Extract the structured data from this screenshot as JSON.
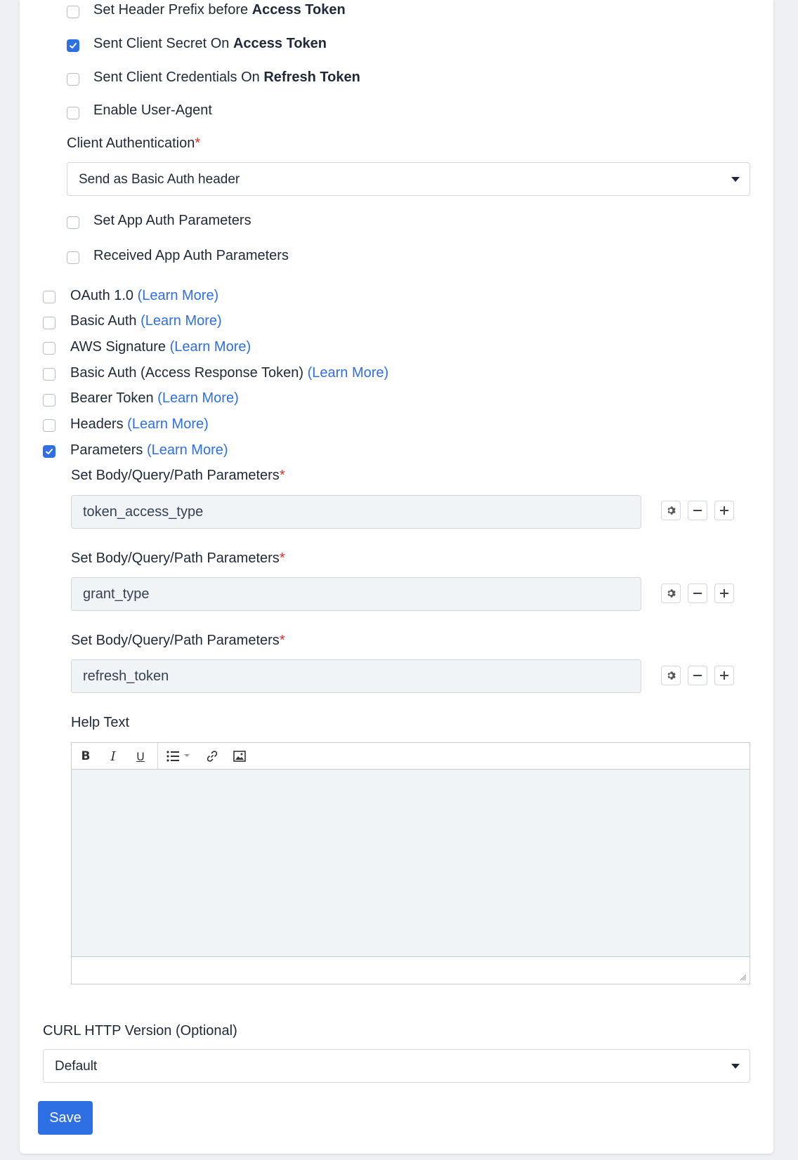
{
  "oauth2_options": [
    {
      "text": "Set Header Prefix before ",
      "bold": "Access Token",
      "checked": false
    },
    {
      "text": "Sent Client Secret On ",
      "bold": "Access Token",
      "checked": true
    },
    {
      "text": "Sent Client Credentials On ",
      "bold": "Refresh Token",
      "checked": false
    },
    {
      "text": "Enable User-Agent",
      "bold": "",
      "checked": false
    }
  ],
  "client_auth": {
    "label": "Client Authentication",
    "required_mark": "*",
    "value": "Send as Basic Auth header"
  },
  "app_auth_options": [
    {
      "text": "Set App Auth Parameters",
      "checked": false
    },
    {
      "text": "Received App Auth Parameters",
      "checked": false
    }
  ],
  "auth_types": [
    {
      "text": "OAuth 1.0",
      "link": "(Learn More)",
      "checked": false
    },
    {
      "text": "Basic Auth",
      "link": "(Learn More)",
      "checked": false
    },
    {
      "text": "AWS Signature",
      "link": "(Learn More)",
      "checked": false
    },
    {
      "text": "Basic Auth (Access Response Token)",
      "link": "(Learn More)",
      "checked": false
    },
    {
      "text": "Bearer Token",
      "link": "(Learn More)",
      "checked": false
    },
    {
      "text": "Headers",
      "link": "(Learn More)",
      "checked": false
    },
    {
      "text": "Parameters",
      "link": "(Learn More)",
      "checked": true
    }
  ],
  "parameters": [
    {
      "label": "Set Body/Query/Path Parameters",
      "required_mark": "*",
      "value": "token_access_type"
    },
    {
      "label": "Set Body/Query/Path Parameters",
      "required_mark": "*",
      "value": "grant_type"
    },
    {
      "label": "Set Body/Query/Path Parameters",
      "required_mark": "*",
      "value": "refresh_token"
    }
  ],
  "help_text": {
    "label": "Help Text",
    "toolbar_icons": [
      "bold-icon",
      "italic-icon",
      "underline-icon",
      "list-icon",
      "link-icon",
      "image-icon"
    ]
  },
  "curl": {
    "label": "CURL HTTP Version (Optional)",
    "value": "Default"
  },
  "save_label": "Save",
  "colors": {
    "accent": "#2f6fe4",
    "required": "#d93025"
  }
}
